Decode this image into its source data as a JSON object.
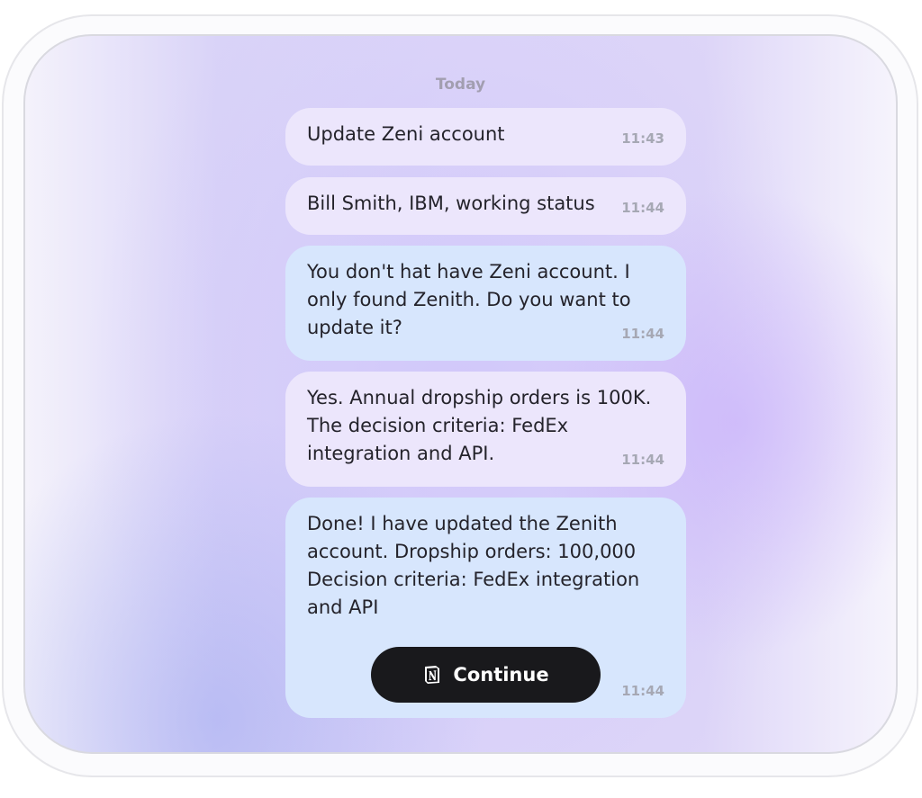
{
  "chat": {
    "date_label": "Today",
    "messages": [
      {
        "role": "user",
        "text": "Update Zeni account",
        "time": "11:43"
      },
      {
        "role": "user",
        "text": "Bill Smith, IBM, working status",
        "time": "11:44"
      },
      {
        "role": "bot",
        "text": "You don't hat have Zeni account. I only found Zenith. Do you want to update it?",
        "time": "11:44"
      },
      {
        "role": "user",
        "text": "Yes. Annual dropship orders is 100K. The decision criteria: FedEx integration and API.",
        "time": "11:44"
      },
      {
        "role": "bot",
        "text": "Done! I have updated the Zenith account. Dropship orders: 100,000\nDecision criteria:  FedEx integration and API",
        "time": "11:44"
      }
    ],
    "continue_button": {
      "label": "Continue",
      "icon": "notion-icon"
    }
  },
  "colors": {
    "user_bubble": "#ece6fc",
    "bot_bubble": "#d7e6fd",
    "button_bg": "#19191c"
  }
}
